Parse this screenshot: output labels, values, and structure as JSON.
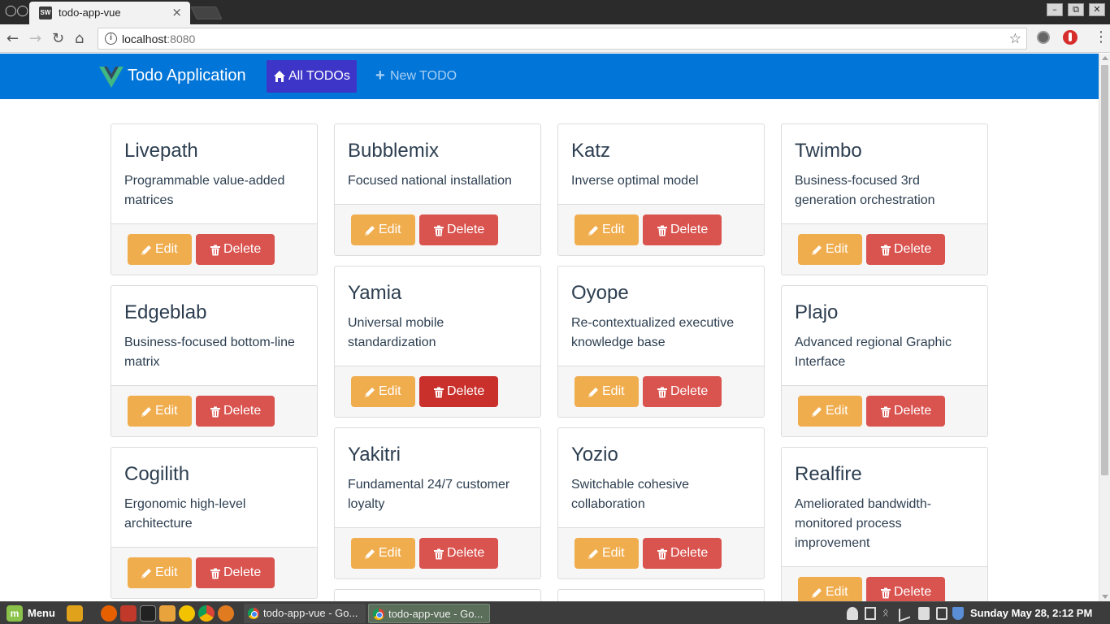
{
  "browser": {
    "tab_title": "todo-app-vue",
    "tab_favicon_text": "SW",
    "url_host": "localhost",
    "url_port": ":8080"
  },
  "navbar": {
    "brand": "Todo Application",
    "brand_color": "#41b883",
    "bg_color": "#0275d8",
    "links": [
      {
        "label": "All TODOs",
        "icon": "home-icon",
        "active": true
      },
      {
        "label": "New TODO",
        "icon": "plus-icon",
        "active": false
      }
    ]
  },
  "buttons": {
    "edit_label": "Edit",
    "delete_label": "Delete",
    "edit_color": "#f0ad4e",
    "delete_color": "#d9534f",
    "delete_active_color": "#c9302c"
  },
  "todos": [
    {
      "title": "Livepath",
      "description": "Programmable value-added matrices"
    },
    {
      "title": "Edgeblab",
      "description": "Business-focused bottom-line matrix"
    },
    {
      "title": "Cogilith",
      "description": "Ergonomic high-level architecture"
    },
    {
      "title": "Bubblemix",
      "description": "Focused national installation"
    },
    {
      "title": "Yamia",
      "description": "Universal mobile standardization"
    },
    {
      "title": "Yakitri",
      "description": "Fundamental 24/7 customer loyalty"
    },
    {
      "title": "Katz",
      "description": "Inverse optimal model"
    },
    {
      "title": "Oyope",
      "description": "Re-contextualized executive knowledge base"
    },
    {
      "title": "Yozio",
      "description": "Switchable cohesive collaboration"
    },
    {
      "title": "Twimbo",
      "description": "Business-focused 3rd generation orchestration"
    },
    {
      "title": "Plajo",
      "description": "Advanced regional Graphic Interface"
    },
    {
      "title": "Realfire",
      "description": "Ameliorated bandwidth-monitored process improvement"
    }
  ],
  "taskbar": {
    "menu_label": "Menu",
    "tasks": [
      "todo-app-vue - Go...",
      "todo-app-vue - Go..."
    ],
    "clock": "Sunday May 28, 2:12 PM"
  }
}
